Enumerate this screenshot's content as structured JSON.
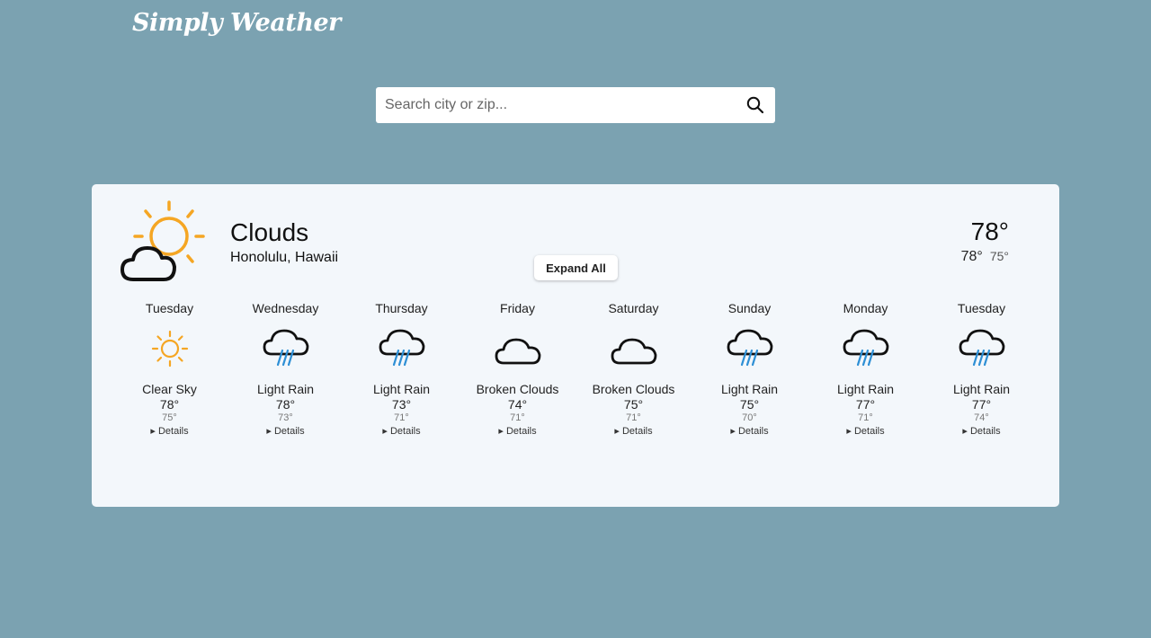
{
  "app": {
    "logo": "Simply Weather"
  },
  "search": {
    "placeholder": "Search city or zip...",
    "value": ""
  },
  "current": {
    "condition": "Clouds",
    "location": "Honolulu, Hawaii",
    "temp": "78°",
    "high": "78°",
    "low": "75°",
    "icon": "sun-cloud-icon"
  },
  "expand_label": "Expand All",
  "details_label": "▸ Details",
  "colors": {
    "background": "#7ba2b1",
    "card": "#f3f7fb",
    "sun": "#f5a623",
    "rain": "#2d8fd5"
  },
  "forecast": [
    {
      "day": "Tuesday",
      "desc": "Clear Sky",
      "hi": "78°",
      "lo": "75°",
      "icon": "sun-icon"
    },
    {
      "day": "Wednesday",
      "desc": "Light Rain",
      "hi": "78°",
      "lo": "73°",
      "icon": "rain-cloud-icon"
    },
    {
      "day": "Thursday",
      "desc": "Light Rain",
      "hi": "73°",
      "lo": "71°",
      "icon": "rain-cloud-icon"
    },
    {
      "day": "Friday",
      "desc": "Broken Clouds",
      "hi": "74°",
      "lo": "71°",
      "icon": "cloud-icon"
    },
    {
      "day": "Saturday",
      "desc": "Broken Clouds",
      "hi": "75°",
      "lo": "71°",
      "icon": "cloud-icon"
    },
    {
      "day": "Sunday",
      "desc": "Light Rain",
      "hi": "75°",
      "lo": "70°",
      "icon": "rain-cloud-icon"
    },
    {
      "day": "Monday",
      "desc": "Light Rain",
      "hi": "77°",
      "lo": "71°",
      "icon": "rain-cloud-icon"
    },
    {
      "day": "Tuesday",
      "desc": "Light Rain",
      "hi": "77°",
      "lo": "74°",
      "icon": "rain-cloud-icon"
    }
  ]
}
